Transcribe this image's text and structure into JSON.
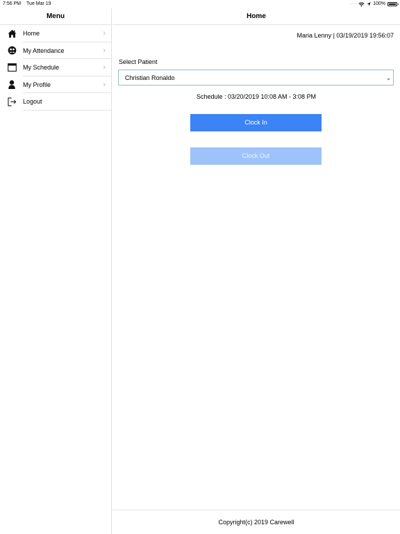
{
  "status_bar": {
    "time": "7:56 PM",
    "date": "Tue Mar 19",
    "battery": "100%"
  },
  "sidebar": {
    "title": "Menu",
    "items": [
      {
        "label": "Home",
        "icon": "home-icon"
      },
      {
        "label": "My Attendance",
        "icon": "attendance-icon"
      },
      {
        "label": "My Schedule",
        "icon": "calendar-icon"
      },
      {
        "label": "My Profile",
        "icon": "profile-icon"
      },
      {
        "label": "Logout",
        "icon": "logout-icon"
      }
    ]
  },
  "main": {
    "title": "Home",
    "user_stamp": "Maria Lenny | 03/19/2019 19:56:07",
    "select_label": "Select Patient",
    "selected_patient": "Christian Ronaldo",
    "schedule": "Schedule : 03/20/2019 10:08 AM - 3:08 PM",
    "clock_in_label": "Clock In",
    "clock_out_label": "Clock Out",
    "footer": "Copyright(c) 2019 Carewell"
  },
  "colors": {
    "clock_in": "#3c83f6",
    "clock_out_disabled": "#9ec3fb",
    "select_border": "#9fb7d2"
  }
}
